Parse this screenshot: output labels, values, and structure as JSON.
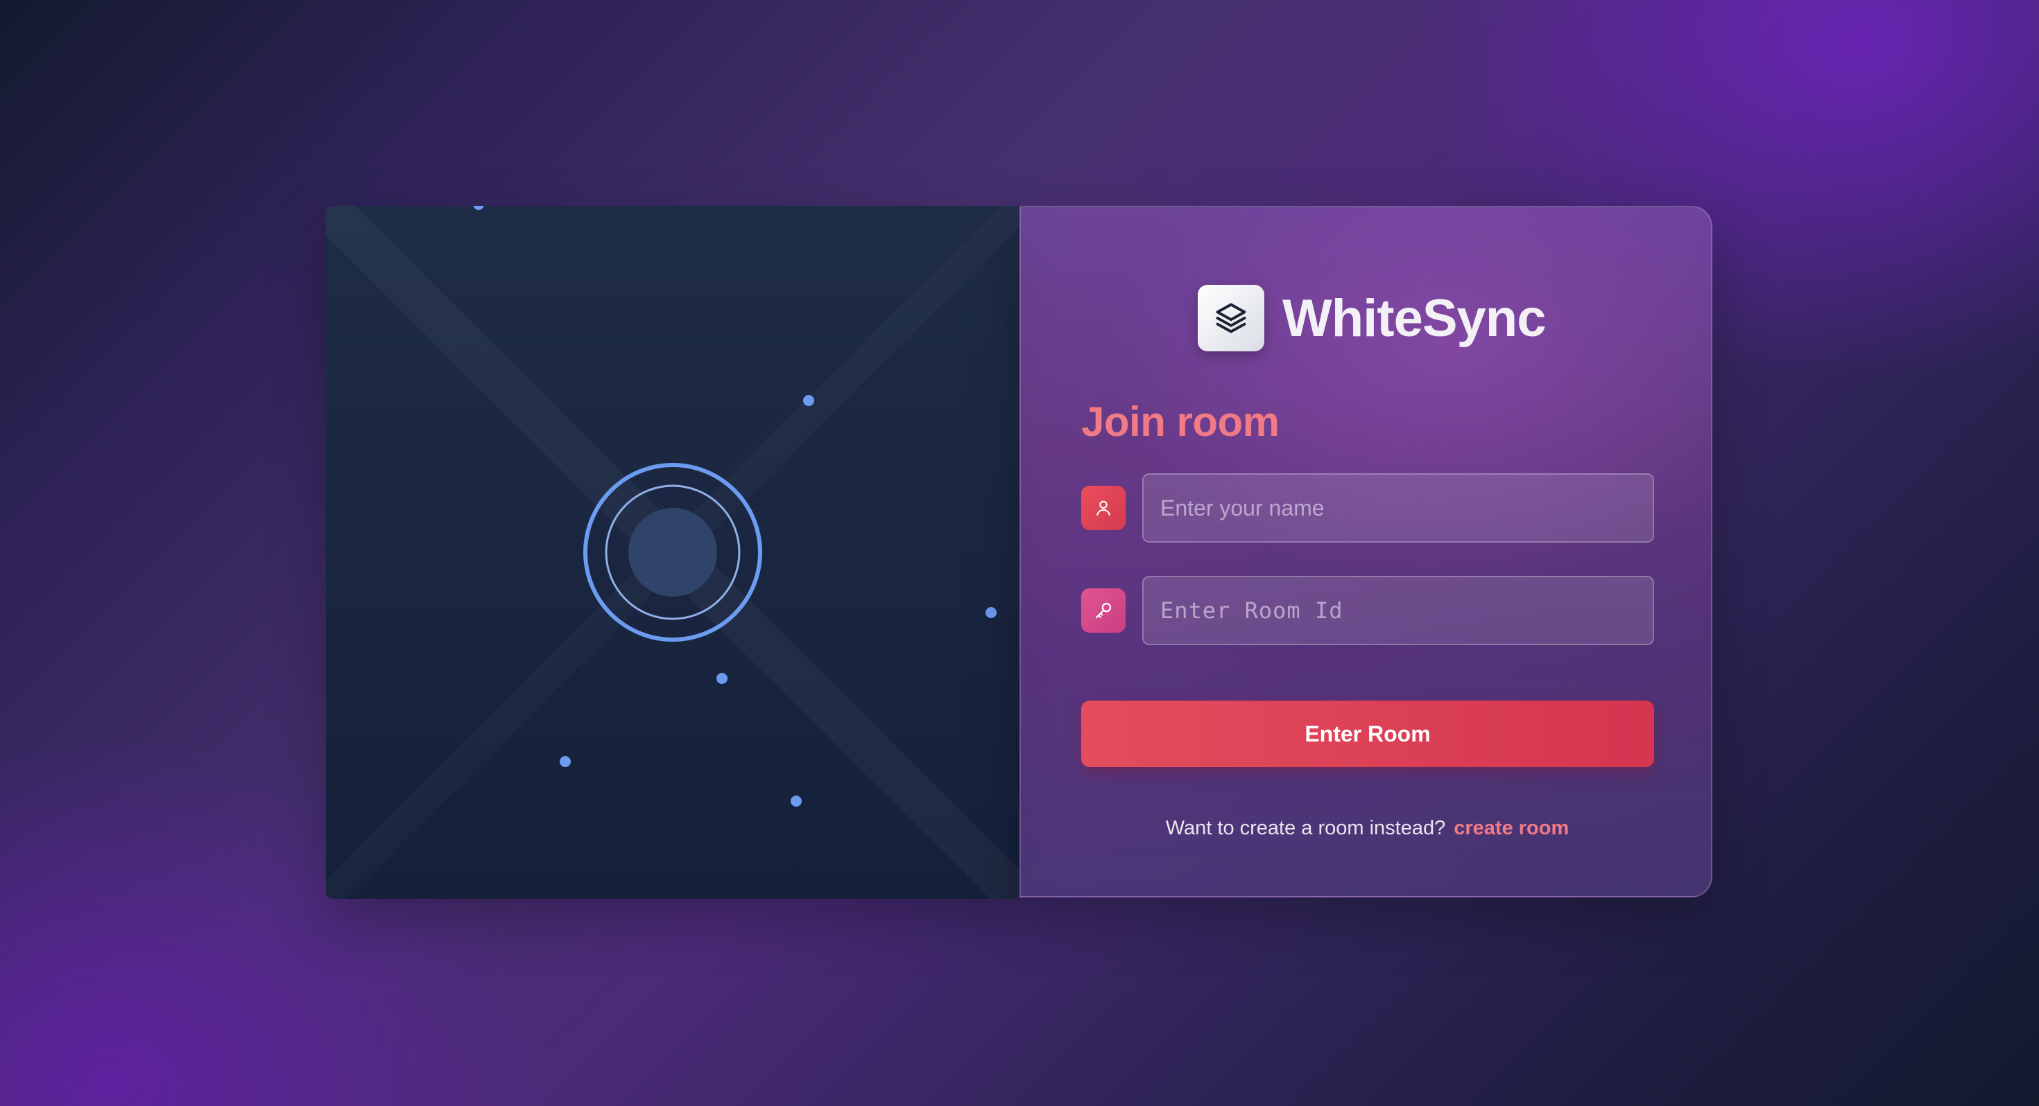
{
  "brand": {
    "name": "WhiteSync",
    "logo_icon": "layers-icon"
  },
  "form": {
    "title": "Join room",
    "name_field": {
      "icon": "user-icon",
      "placeholder": "Enter your name",
      "value": ""
    },
    "room_field": {
      "icon": "key-icon",
      "placeholder": "Enter Room Id",
      "value": ""
    },
    "submit_label": "Enter Room",
    "alt_prompt": "Want to create a room instead?",
    "alt_link": "create room"
  },
  "colors": {
    "accent": "#f07a86",
    "button": "#dc4156",
    "visual_ring": "#6b9cf0",
    "visual_panel": "#1d2943"
  }
}
